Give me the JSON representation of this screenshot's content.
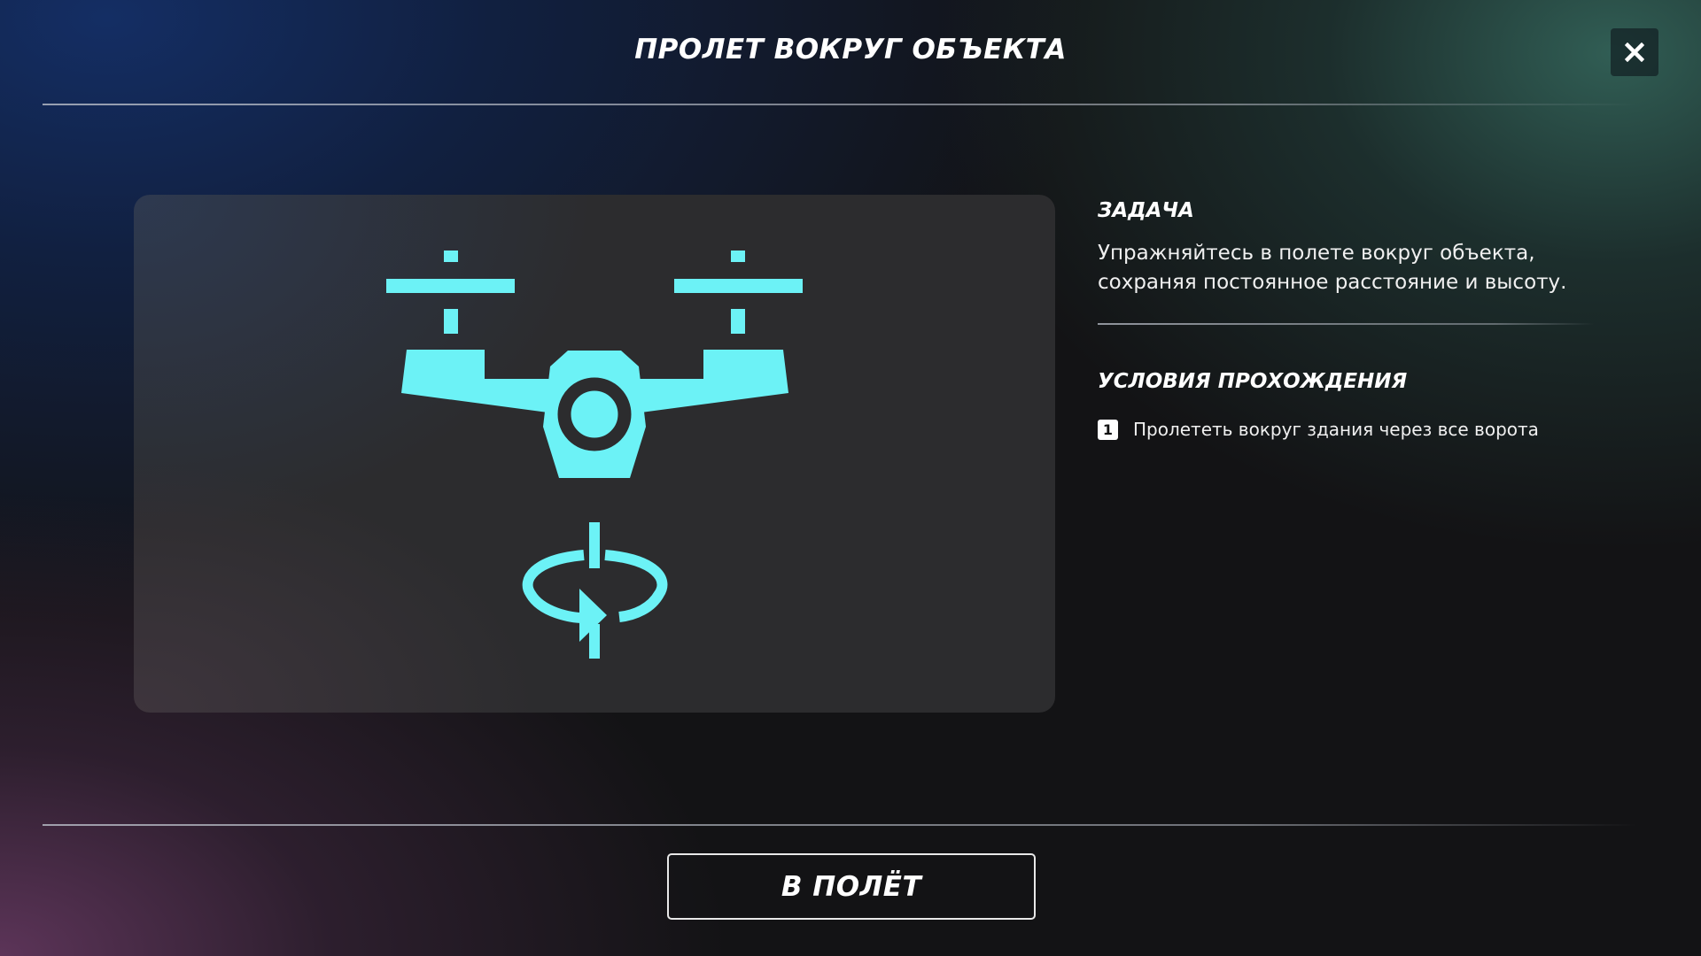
{
  "header": {
    "title": "ПРОЛЕТ ВОКРУГ ОБЪЕКТА",
    "close_icon": "close-icon"
  },
  "preview": {
    "icon": "drone-orbit-icon",
    "accent_color": "#6cf2f6"
  },
  "task": {
    "heading": "ЗАДАЧА",
    "description": "Упражняйтесь в полете вокруг объекта, сохраняя постоянное расстояние и высоту."
  },
  "conditions": {
    "heading": "УСЛОВИЯ ПРОХОЖДЕНИЯ",
    "items": [
      {
        "number": "1",
        "text": "Пролететь вокруг здания через все ворота"
      }
    ]
  },
  "footer": {
    "start_button": "В ПОЛЁТ"
  },
  "colors": {
    "accent": "#6cf2f6",
    "background": "#131315",
    "panel": "#2c2c2e"
  }
}
